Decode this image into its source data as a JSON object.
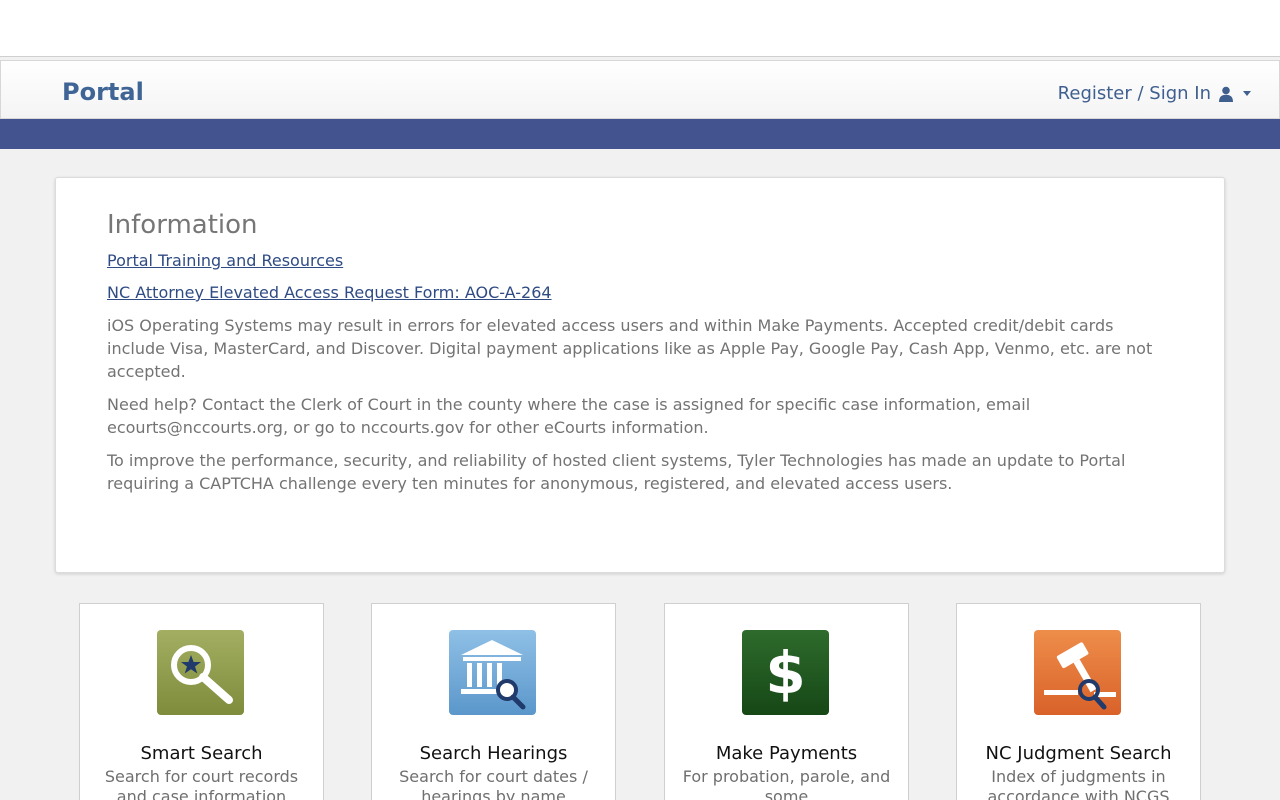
{
  "header": {
    "brand": "Portal",
    "signin_label": "Register / Sign In"
  },
  "info": {
    "title": "Information",
    "links": [
      "Portal Training and Resources",
      "NC Attorney Elevated Access Request Form: AOC-A-264"
    ],
    "paragraphs": [
      "iOS Operating Systems may result in errors for elevated access users and within Make Payments. Accepted credit/debit cards include Visa, MasterCard, and Discover. Digital payment applications like as Apple Pay, Google Pay, Cash App, Venmo, etc. are not accepted.",
      "Need help? Contact the Clerk of Court in the county where the case is assigned for specific case information, email ecourts@nccourts.org, or go to nccourts.gov for other eCourts information.",
      "To improve the performance, security, and reliability of hosted client systems, Tyler Technologies has made an update to Portal requiring a CAPTCHA challenge every ten minutes for anonymous, registered, and elevated access users."
    ]
  },
  "tiles": [
    {
      "title": "Smart Search",
      "desc": "Search for court records and case information",
      "icon": "magnifier-star-icon",
      "color": "#8f9a4a"
    },
    {
      "title": "Search Hearings",
      "desc": "Search for court dates / hearings by name",
      "icon": "courthouse-search-icon",
      "color": "#6fa8d6"
    },
    {
      "title": "Make Payments",
      "desc": "For probation, parole, and some",
      "icon": "dollar-icon",
      "color": "#1f5a1f"
    },
    {
      "title": "NC Judgment Search",
      "desc": "Index of judgments in accordance with NCGS",
      "icon": "gavel-search-icon",
      "color": "#e4733a"
    }
  ],
  "colors": {
    "brand": "#3f6596",
    "band": "#43538f",
    "link": "#2f4b84"
  }
}
